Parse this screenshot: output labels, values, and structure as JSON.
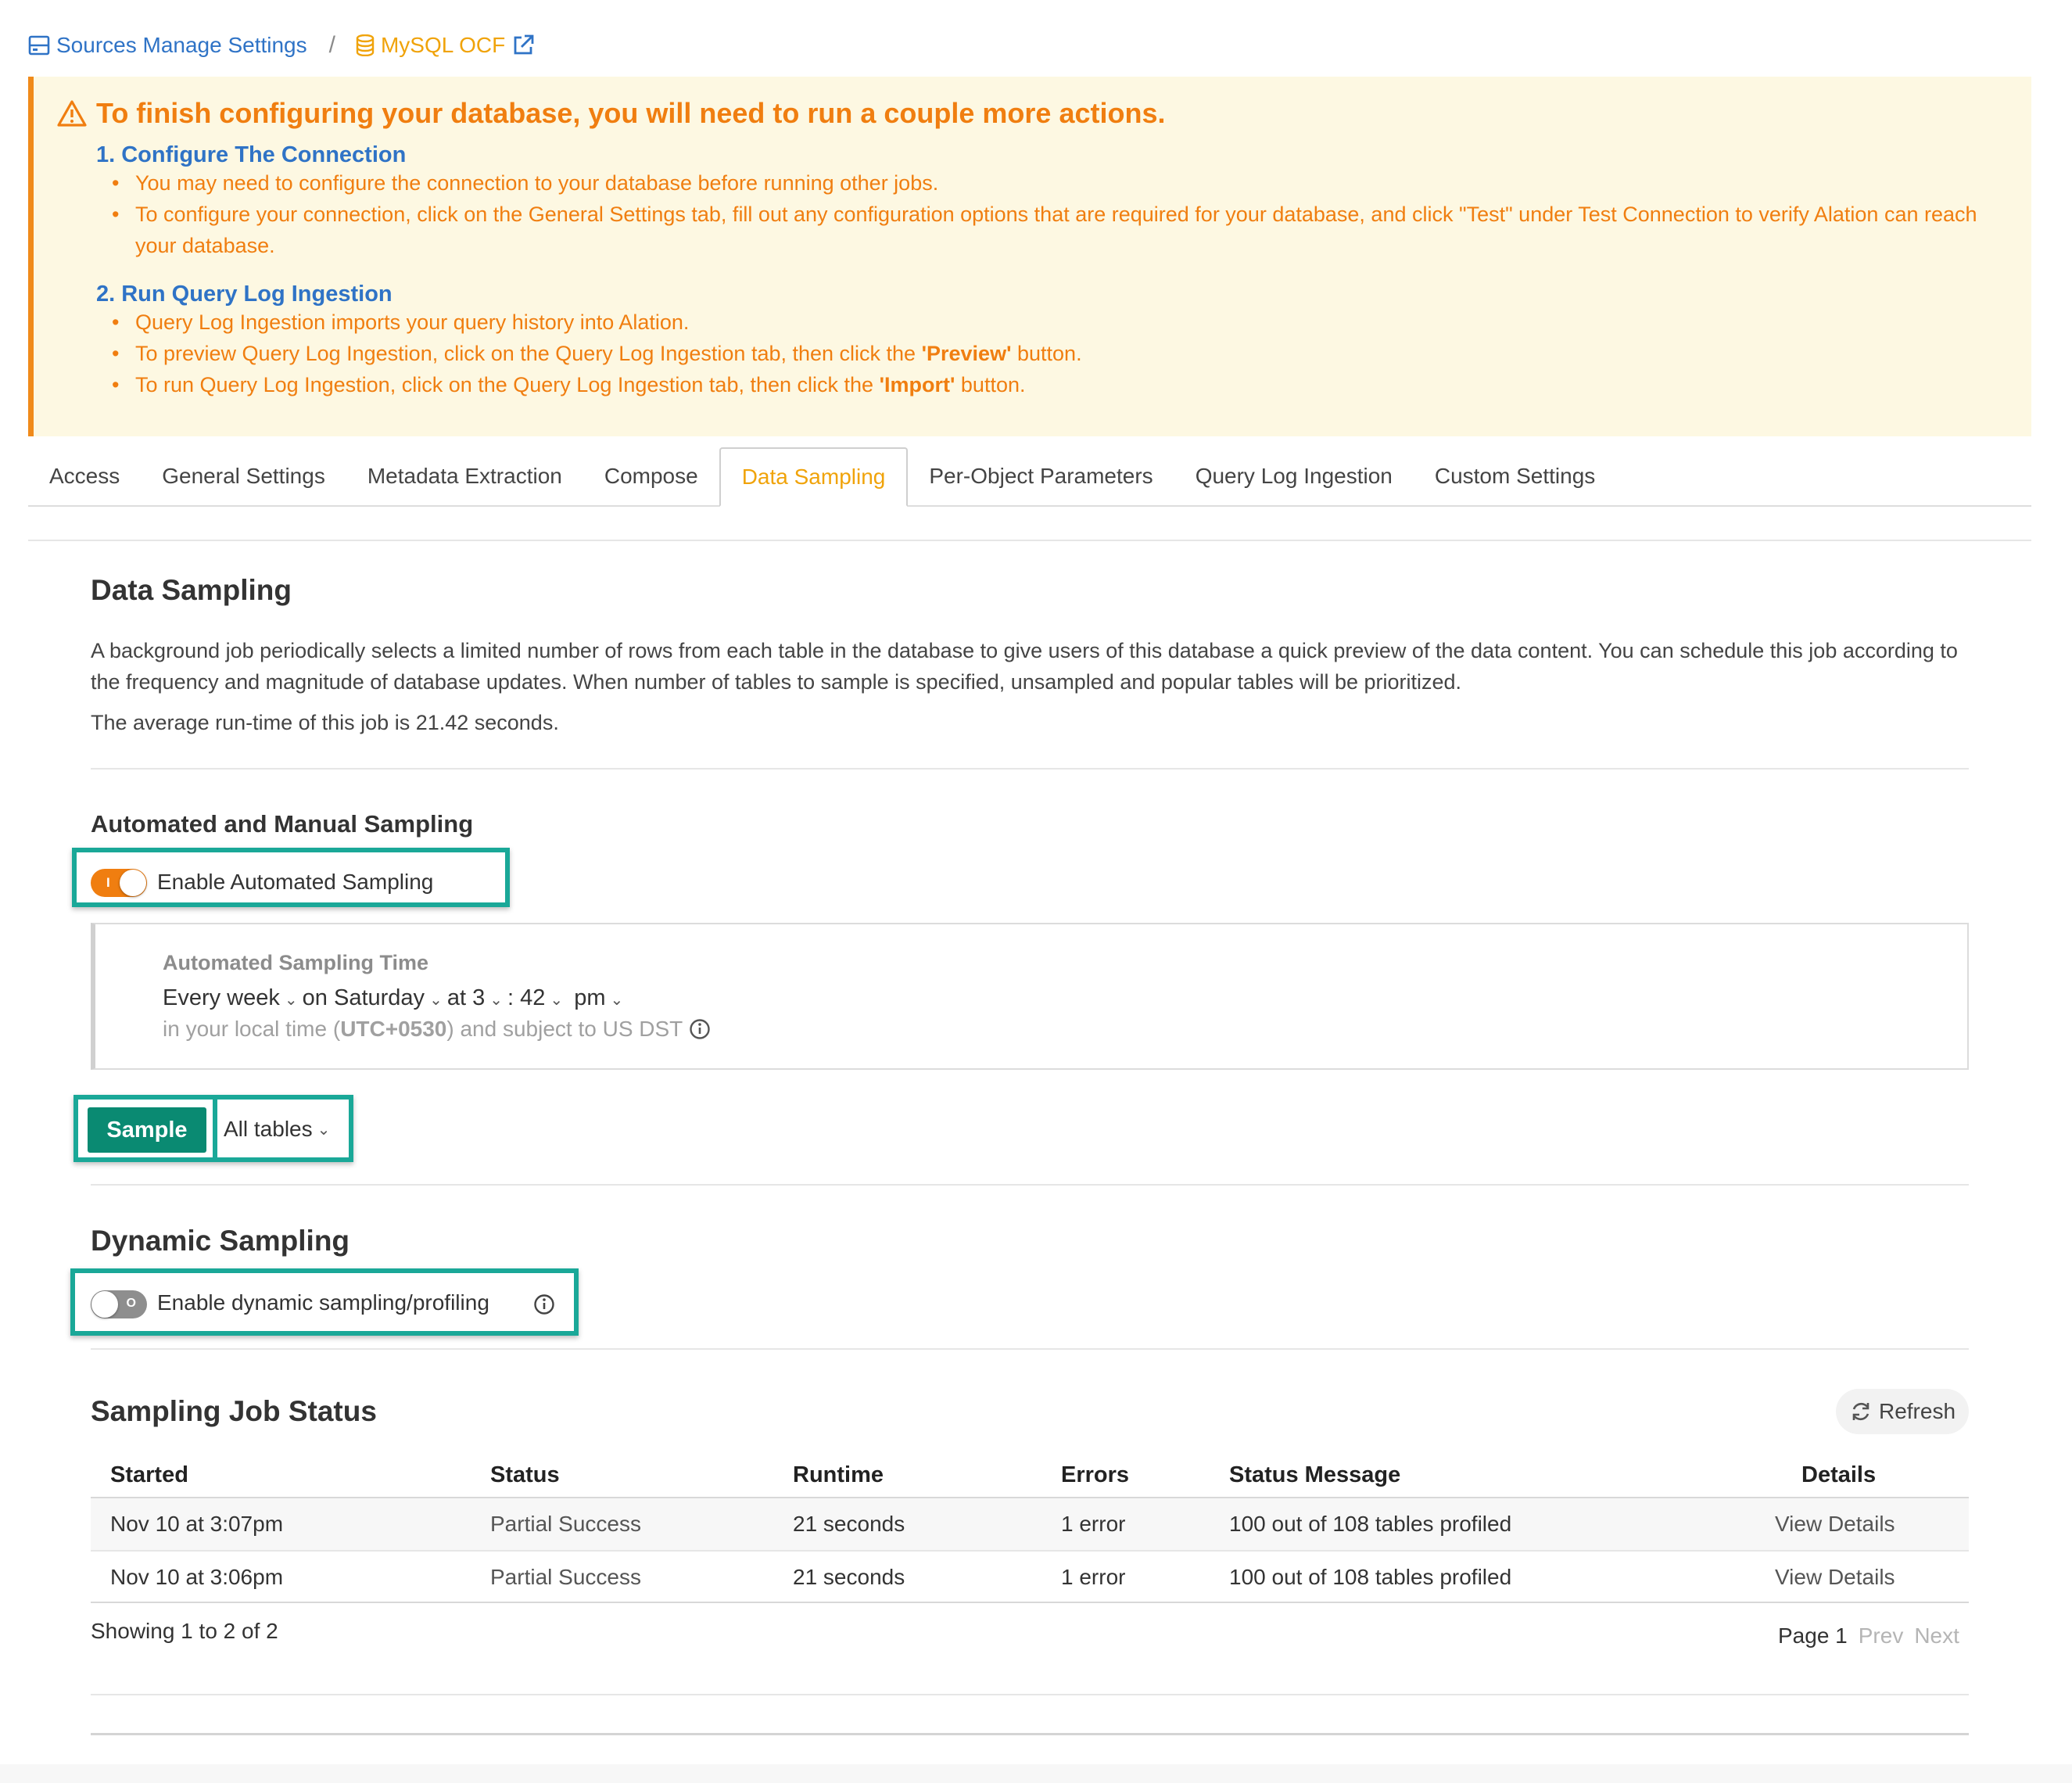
{
  "breadcrumb": {
    "parent": "Sources Manage Settings",
    "separator": "/",
    "current": "MySQL OCF"
  },
  "banner": {
    "title": "To finish configuring your database, you will need to run a couple more actions.",
    "step1": {
      "title": "1. Configure The Connection",
      "items": [
        "You may need to configure the connection to your database before running other jobs.",
        "To configure your connection, click on the General Settings tab, fill out any configuration options that are required for your database, and click \"Test\" under Test Connection to verify Alation can reach your database."
      ]
    },
    "step2": {
      "title": "2. Run Query Log Ingestion",
      "item1": "Query Log Ingestion imports your query history into Alation.",
      "item2_pre": "To preview Query Log Ingestion, click on the Query Log Ingestion tab, then click the ",
      "item2_bold": "'Preview'",
      "item2_post": " button.",
      "item3_pre": "To run Query Log Ingestion, click on the Query Log Ingestion tab, then click the ",
      "item3_bold": "'Import'",
      "item3_post": " button."
    }
  },
  "tabs": [
    {
      "label": "Access"
    },
    {
      "label": "General Settings"
    },
    {
      "label": "Metadata Extraction"
    },
    {
      "label": "Compose"
    },
    {
      "label": "Data Sampling",
      "active": true
    },
    {
      "label": "Per-Object Parameters"
    },
    {
      "label": "Query Log Ingestion"
    },
    {
      "label": "Custom Settings"
    }
  ],
  "data_sampling": {
    "title": "Data Sampling",
    "description": "A background job periodically selects a limited number of rows from each table in the database to give users of this database a quick preview of the data content. You can schedule this job according to the frequency and magnitude of database updates. When number of tables to sample is specified, unsampled and popular tables will be prioritized.",
    "avg_runtime": "The average run-time of this job is 21.42 seconds."
  },
  "automated": {
    "title": "Automated and Manual Sampling",
    "toggle_label": "Enable Automated Sampling",
    "toggle_on": true,
    "toggle_mark": "I",
    "time_title": "Automated Sampling Time",
    "frequency": "Every week",
    "day_prefix": "on",
    "day": "Saturday",
    "at": "at",
    "hour": "3",
    "colon": ":",
    "minute": "42",
    "ampm": "pm",
    "note_pre": "in your local time (",
    "note_tz": "UTC+0530",
    "note_post": ") and subject to US DST",
    "sample_button": "Sample",
    "tables_select": "All tables"
  },
  "dynamic": {
    "title": "Dynamic Sampling",
    "toggle_label": "Enable dynamic sampling/profiling",
    "toggle_on": false,
    "toggle_mark": "O"
  },
  "job_status": {
    "title": "Sampling Job Status",
    "refresh_label": "Refresh",
    "columns": [
      "Started",
      "Status",
      "Runtime",
      "Errors",
      "Status Message",
      "Details"
    ],
    "rows": [
      {
        "started": "Nov 10 at 3:07pm",
        "status": "Partial Success",
        "runtime": "21 seconds",
        "errors": "1 error",
        "message": "100 out of 108 tables profiled",
        "details": "View Details"
      },
      {
        "started": "Nov 10 at 3:06pm",
        "status": "Partial Success",
        "runtime": "21 seconds",
        "errors": "1 error",
        "message": "100 out of 108 tables profiled",
        "details": "View Details"
      }
    ],
    "showing": "Showing 1 to 2 of 2",
    "page": "Page 1",
    "prev": "Prev",
    "next": "Next"
  },
  "colors": {
    "link": "#2f73c6",
    "warning": "#f07e10",
    "accent": "#f0a30a",
    "primary_button": "#0a8a72",
    "highlight": "#1aa898"
  }
}
